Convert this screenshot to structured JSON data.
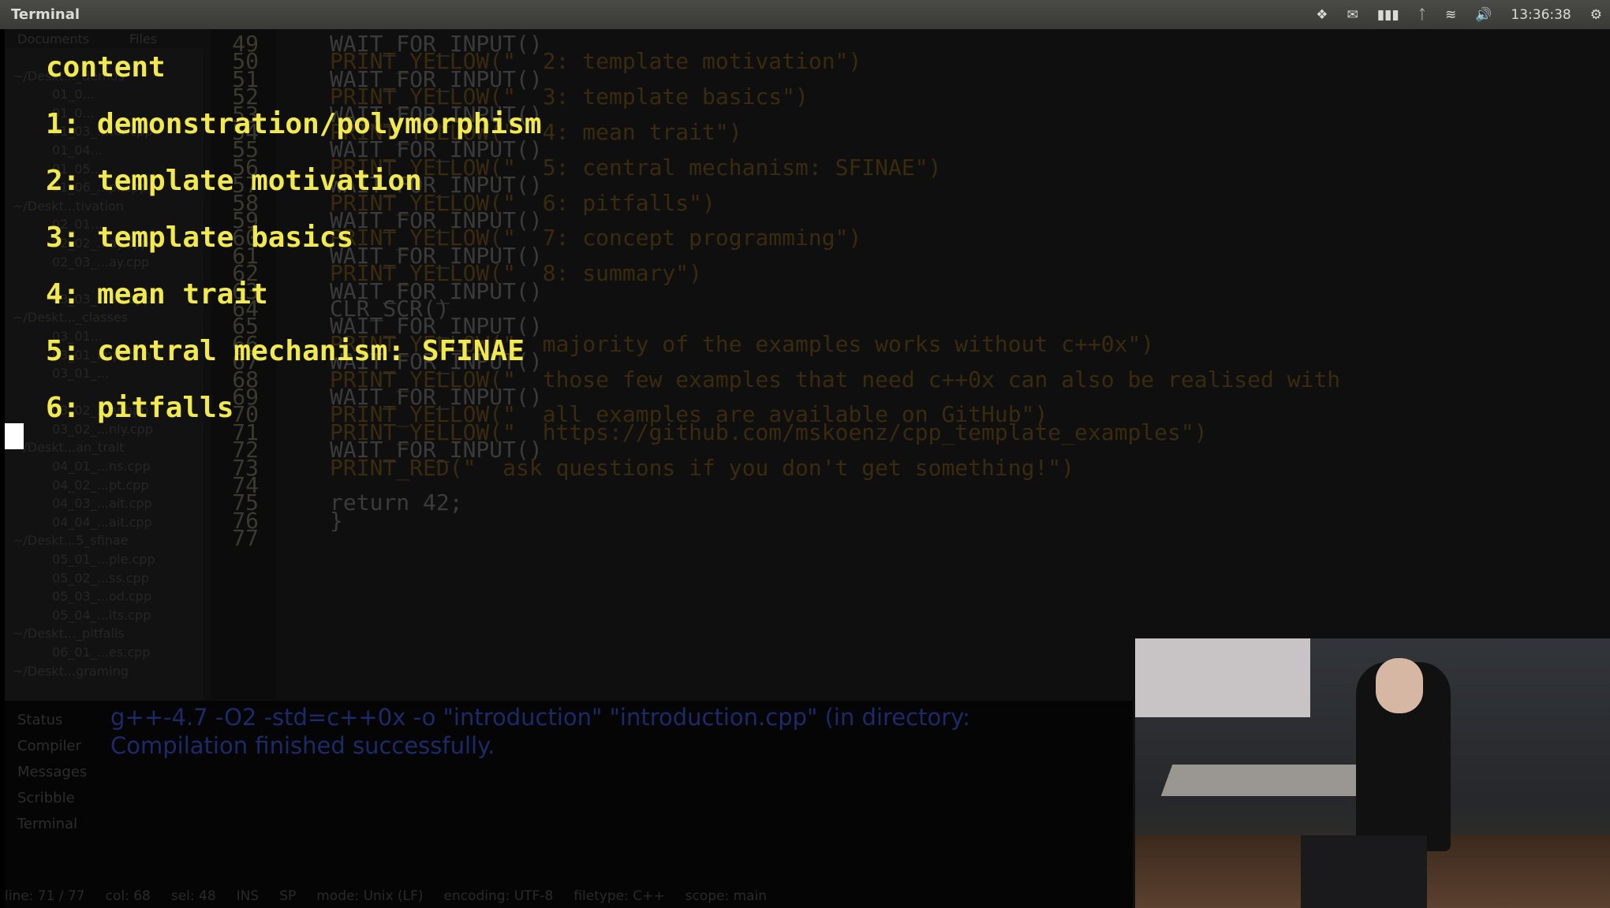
{
  "window": {
    "title": "Terminal",
    "clock": "13:36:38"
  },
  "tray": [
    {
      "icon": "dropbox-icon"
    },
    {
      "icon": "mail-icon"
    },
    {
      "icon": "battery-icon"
    },
    {
      "icon": "bluetooth-icon"
    },
    {
      "icon": "wifi-icon"
    },
    {
      "icon": "volume-icon"
    },
    {
      "icon": "gear-icon"
    }
  ],
  "sidebar": {
    "tabs": [
      "Documents",
      "Files"
    ],
    "rows": [
      {
        "type": "folder",
        "label": ""
      },
      {
        "type": "folder",
        "label": "~/Deskt..._demos"
      },
      {
        "type": "file",
        "label": "01_0..."
      },
      {
        "type": "file",
        "label": "01_0..."
      },
      {
        "type": "file",
        "label": "01_03_...tor.cpp"
      },
      {
        "type": "file",
        "label": "01_04..."
      },
      {
        "type": "file",
        "label": "01_05..."
      },
      {
        "type": "file",
        "label": "01_06_...pl.cpp"
      },
      {
        "type": "folder",
        "label": "~/Deskt...tivation"
      },
      {
        "type": "file",
        "label": "02_01..."
      },
      {
        "type": "file",
        "label": "02_02_...ay.cpp"
      },
      {
        "type": "file",
        "label": "02_03_...ay.cpp"
      },
      {
        "type": "folder",
        "label": ""
      },
      {
        "type": "file",
        "label": "03_03_...on.cpp"
      },
      {
        "type": "folder",
        "label": "~/Deskt..._classes"
      },
      {
        "type": "file",
        "label": "03_01..."
      },
      {
        "type": "file",
        "label": "03_01_impl.cpp"
      },
      {
        "type": "file",
        "label": "03_01_..."
      },
      {
        "type": "folder",
        "label": ""
      },
      {
        "type": "file",
        "label": "03_02_...er.hpp"
      },
      {
        "type": "file",
        "label": "03_02_...nly.cpp"
      },
      {
        "type": "folder",
        "label": "~/Deskt...an_trait"
      },
      {
        "type": "file",
        "label": "04_01_...ns.cpp"
      },
      {
        "type": "file",
        "label": "04_02_...pt.cpp"
      },
      {
        "type": "file",
        "label": "04_03_...ait.cpp"
      },
      {
        "type": "file",
        "label": "04_04_...ait.cpp"
      },
      {
        "type": "folder",
        "label": "~/Deskt...5_sfinae"
      },
      {
        "type": "file",
        "label": "05_01_...ple.cpp"
      },
      {
        "type": "file",
        "label": "05_02_...ss.cpp"
      },
      {
        "type": "file",
        "label": "05_03_...od.cpp"
      },
      {
        "type": "file",
        "label": "05_04_...its.cpp"
      },
      {
        "type": "folder",
        "label": "~/Deskt..._pitfalls"
      },
      {
        "type": "file",
        "label": "06_01_...es.cpp"
      },
      {
        "type": "folder",
        "label": "~/Deskt...graming"
      }
    ]
  },
  "editor": {
    "lines": [
      {
        "n": "49",
        "text": "WAIT_FOR_INPUT()"
      },
      {
        "n": "50",
        "text": "PRINT_YELLOW(\"  2: template motivation\")"
      },
      {
        "n": "51",
        "text": "WAIT_FOR_INPUT()"
      },
      {
        "n": "52",
        "text": "PRINT_YELLOW(\"  3: template basics\")"
      },
      {
        "n": "53",
        "text": "WAIT_FOR_INPUT()"
      },
      {
        "n": "54",
        "text": "PRINT_YELLOW(\"  4: mean trait\")"
      },
      {
        "n": "55",
        "text": "WAIT_FOR_INPUT()"
      },
      {
        "n": "56",
        "text": "PRINT_YELLOW(\"  5: central mechanism: SFINAE\")"
      },
      {
        "n": "57",
        "text": "WAIT_FOR_INPUT()"
      },
      {
        "n": "58",
        "text": "PRINT_YELLOW(\"  6: pitfalls\")"
      },
      {
        "n": "59",
        "text": "WAIT_FOR_INPUT()"
      },
      {
        "n": "60",
        "text": "PRINT_YELLOW(\"  7: concept programming\")"
      },
      {
        "n": "61",
        "text": "WAIT_FOR_INPUT()"
      },
      {
        "n": "62",
        "text": "PRINT_YELLOW(\"  8: summary\")"
      },
      {
        "n": "63",
        "text": "WAIT_FOR_INPUT()"
      },
      {
        "n": "64",
        "text": "CLR_SCR()"
      },
      {
        "n": "65",
        "text": "WAIT_FOR_INPUT()"
      },
      {
        "n": "66",
        "text": "PRINT_YELLOW(\"  majority of the examples works without c++0x\")"
      },
      {
        "n": "67",
        "text": "WAIT_FOR_INPUT()"
      },
      {
        "n": "68",
        "text": "PRINT_YELLOW(\"  those few examples that need c++0x can also be realised with"
      },
      {
        "n": "69",
        "text": "WAIT_FOR_INPUT()"
      },
      {
        "n": "70",
        "text": "PRINT_YELLOW(\"  all examples are available on GitHub\")"
      },
      {
        "n": "71",
        "text": "PRINT_YELLOW(\"  https://github.com/mskoenz/cpp_template_examples\")"
      },
      {
        "n": "72",
        "text": "WAIT_FOR_INPUT()"
      },
      {
        "n": "73",
        "text": "PRINT_RED(\"  ask questions if you don't get something!\")"
      },
      {
        "n": "74",
        "text": ""
      },
      {
        "n": "75",
        "text": "return 42;"
      },
      {
        "n": "76",
        "text": "}"
      },
      {
        "n": "77",
        "text": ""
      }
    ]
  },
  "overlay": {
    "title": "content",
    "items": [
      "1: demonstration/polymorphism",
      "2: template motivation",
      "3: template basics",
      "4: mean trait",
      "5: central mechanism: SFINAE",
      "6: pitfalls"
    ]
  },
  "messages": {
    "tabs": [
      "Status",
      "Compiler",
      "Messages",
      "Scribble",
      "Terminal"
    ],
    "lines": [
      "g++-4.7 -O2 -std=c++0x -o \"introduction\" \"introduction.cpp\" (in directory:",
      "Compilation finished successfully."
    ]
  },
  "statusbar": {
    "items": [
      "line: 71 / 77",
      "col: 68",
      "sel: 48",
      "INS",
      "SP",
      "mode: Unix (LF)",
      "encoding: UTF-8",
      "filetype: C++",
      "scope: main"
    ]
  }
}
